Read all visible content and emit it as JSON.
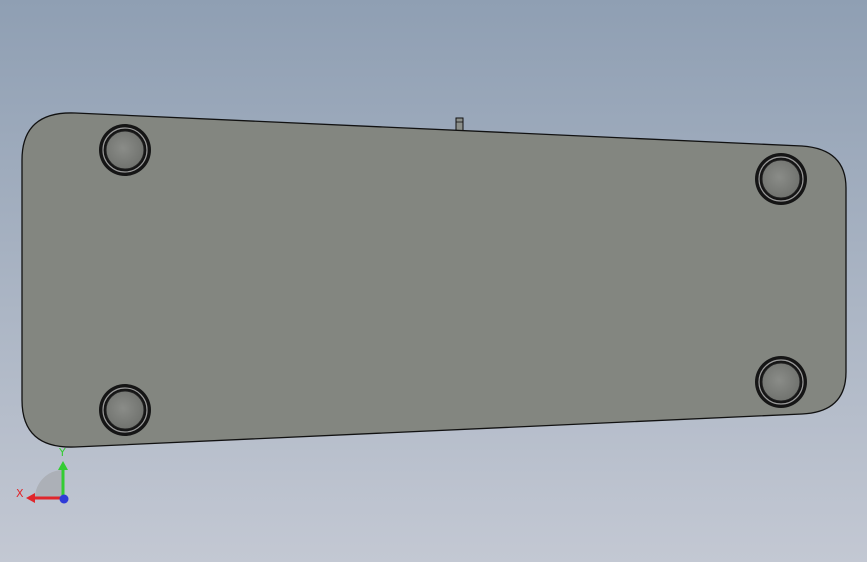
{
  "viewport": {
    "background_top": "#8f9fb3",
    "background_bottom": "#c3c8d3"
  },
  "part": {
    "face_color": "#838680",
    "edge_color": "#111111",
    "hole_count": 4
  },
  "triad": {
    "x_label": "X",
    "y_label": "Y",
    "x_color": "#e0262b",
    "y_color": "#33cc33",
    "z_color": "#2f3bd8"
  }
}
